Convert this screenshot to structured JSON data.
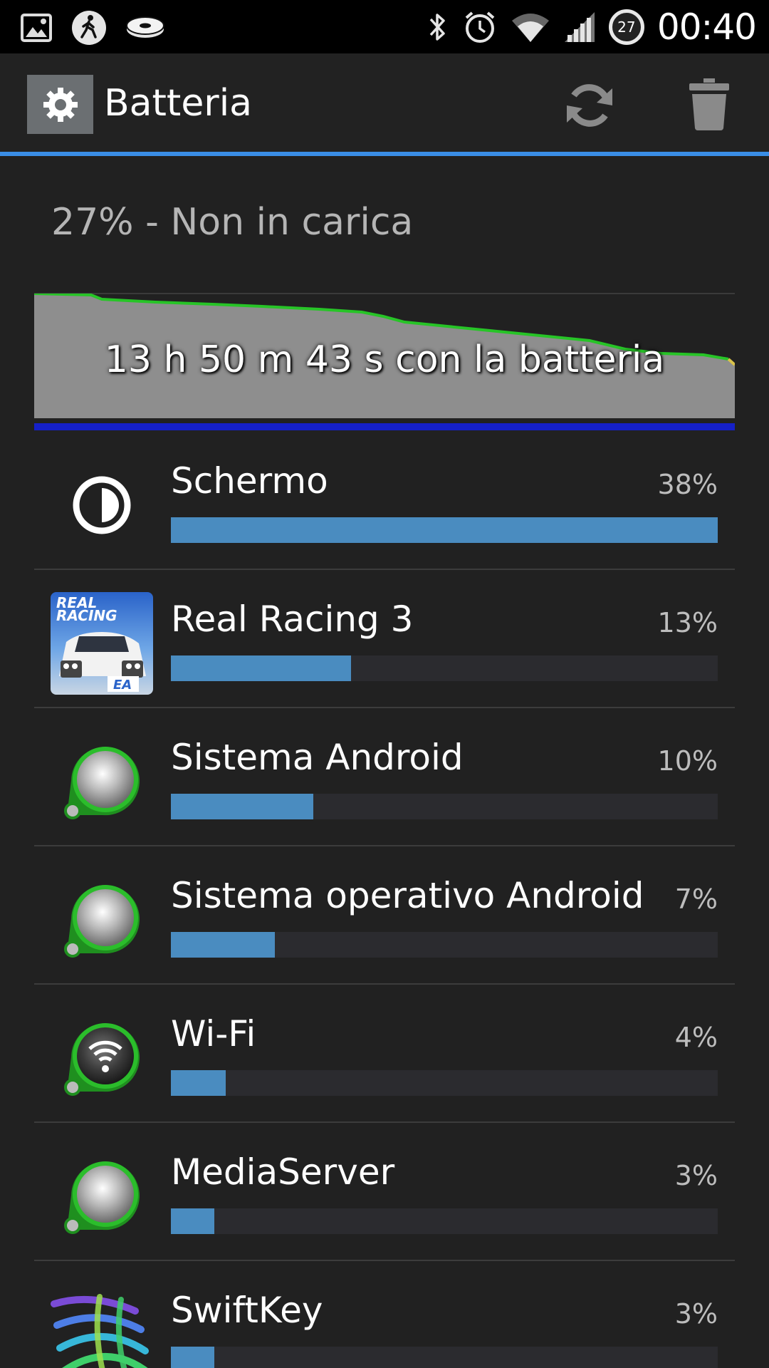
{
  "status_bar": {
    "time": "00:40",
    "battery_level": "27",
    "icons": [
      "gallery-icon",
      "walk-icon",
      "disc-icon",
      "bluetooth-icon",
      "alarm-icon",
      "wifi-icon",
      "signal-icon",
      "battery-circle-icon"
    ]
  },
  "action_bar": {
    "title": "Batteria",
    "icons": [
      "settings-logo-icon",
      "refresh-icon",
      "trash-icon"
    ]
  },
  "summary": {
    "text": "27% - Non in carica"
  },
  "graph": {
    "label": "13 h 50 m 43 s con la batteria",
    "colors": {
      "fill": "#8e8e8e",
      "line": "#27c427",
      "baseline": "#1520c8",
      "tail": "#d9c24a"
    }
  },
  "usage": {
    "items": [
      {
        "name": "Schermo",
        "percent_label": "38%",
        "bar_fraction": 1.0,
        "icon": "screen-brightness-icon"
      },
      {
        "name": "Real Racing 3",
        "percent_label": "13%",
        "bar_fraction": 0.33,
        "icon": "real-racing-app-icon"
      },
      {
        "name": "Sistema Android",
        "percent_label": "10%",
        "bar_fraction": 0.26,
        "icon": "android-system-icon"
      },
      {
        "name": "Sistema operativo Android",
        "percent_label": "7%",
        "bar_fraction": 0.19,
        "icon": "android-os-icon"
      },
      {
        "name": "Wi-Fi",
        "percent_label": "4%",
        "bar_fraction": 0.1,
        "icon": "wifi-app-icon"
      },
      {
        "name": "MediaServer",
        "percent_label": "3%",
        "bar_fraction": 0.08,
        "icon": "mediaserver-icon"
      },
      {
        "name": "SwiftKey",
        "percent_label": "3%",
        "bar_fraction": 0.08,
        "icon": "swiftkey-icon"
      }
    ]
  },
  "app_icon_text": {
    "real_racing_line1": "REAL",
    "real_racing_line2": "RACING",
    "real_racing_badge": "EA"
  }
}
